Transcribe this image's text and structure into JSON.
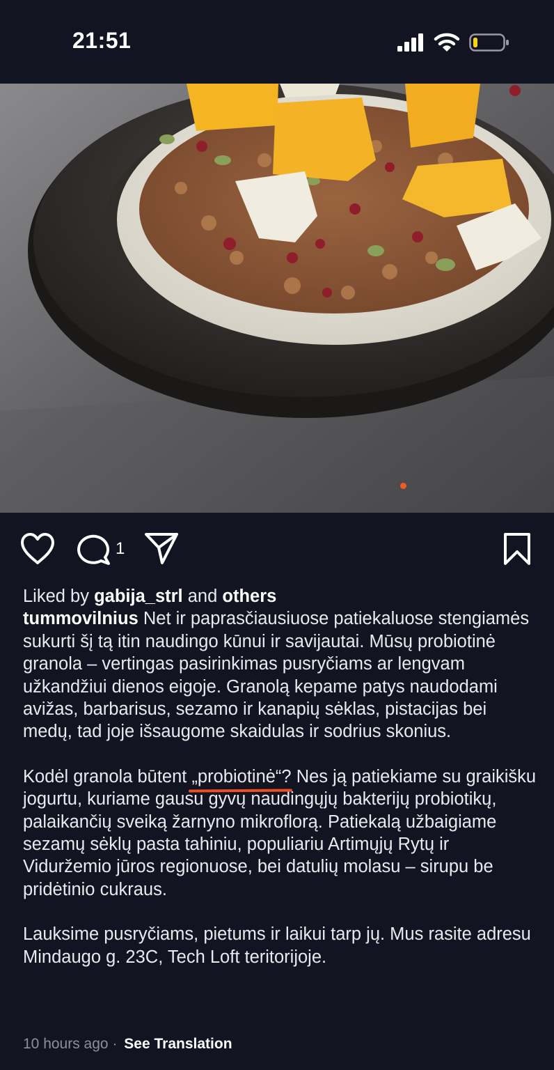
{
  "status_bar": {
    "time": "21:51"
  },
  "post": {
    "comment_count": "1",
    "liked_by": {
      "prefix": "Liked by",
      "user": "gabija_strl",
      "connector": "and",
      "others": "others"
    },
    "author": "tummovilnius",
    "caption": {
      "p1_start": "Net ir paprasčiausiuose patiekaluose stengiamės sukurti šį tą itin naudingo kūnui ir savijautai.",
      "p1_highlight": "Mūsų probiotinė granola",
      "p1_rest": " – vertingas pasirinkimas pusryčiams ar lengvam užkandžiui dienos eigoje. Granolą kepame patys naudodami avižas, barbarisus, sezamo ir kanapių sėklas, pistacijas bei medų, tad joje išsaugome skaidulas ir sodrius skonius.",
      "p2_start": "Kodėl granola būtent ",
      "p2_highlight": "„probiotinė“?",
      "p2_rest": " Nes ją patiekiame su graikišku jogurtu, kuriame gausu gyvų naudingųjų bakterijų probiotikų, palaikančių sveiką žarnyno mikroflorą. Patiekalą užbaigiame sezamų sėklų pasta tahiniu, populiariu Artimųjų Rytų ir Viduržemio jūros regionuose, bei datulių molasu – sirupu be pridėtinio cukraus.",
      "p3": "Lauksime pusryčiams, pietums ir laikui tarp jų. Mus rasite adresu Mindaugo g. 23C, Tech Loft teritorijoje."
    },
    "timestamp": "10 hours ago",
    "separator": "·",
    "see_translation": "See Translation"
  },
  "colors": {
    "background": "#121421",
    "underline": "#ee4f22",
    "carousel_dot": "#f25a24",
    "muted": "#8d8f99"
  },
  "icons": [
    "heart-icon",
    "comment-bubble-icon",
    "share-paper-plane-icon",
    "bookmark-icon",
    "cellular-signal-icon",
    "wifi-icon",
    "battery-icon"
  ]
}
